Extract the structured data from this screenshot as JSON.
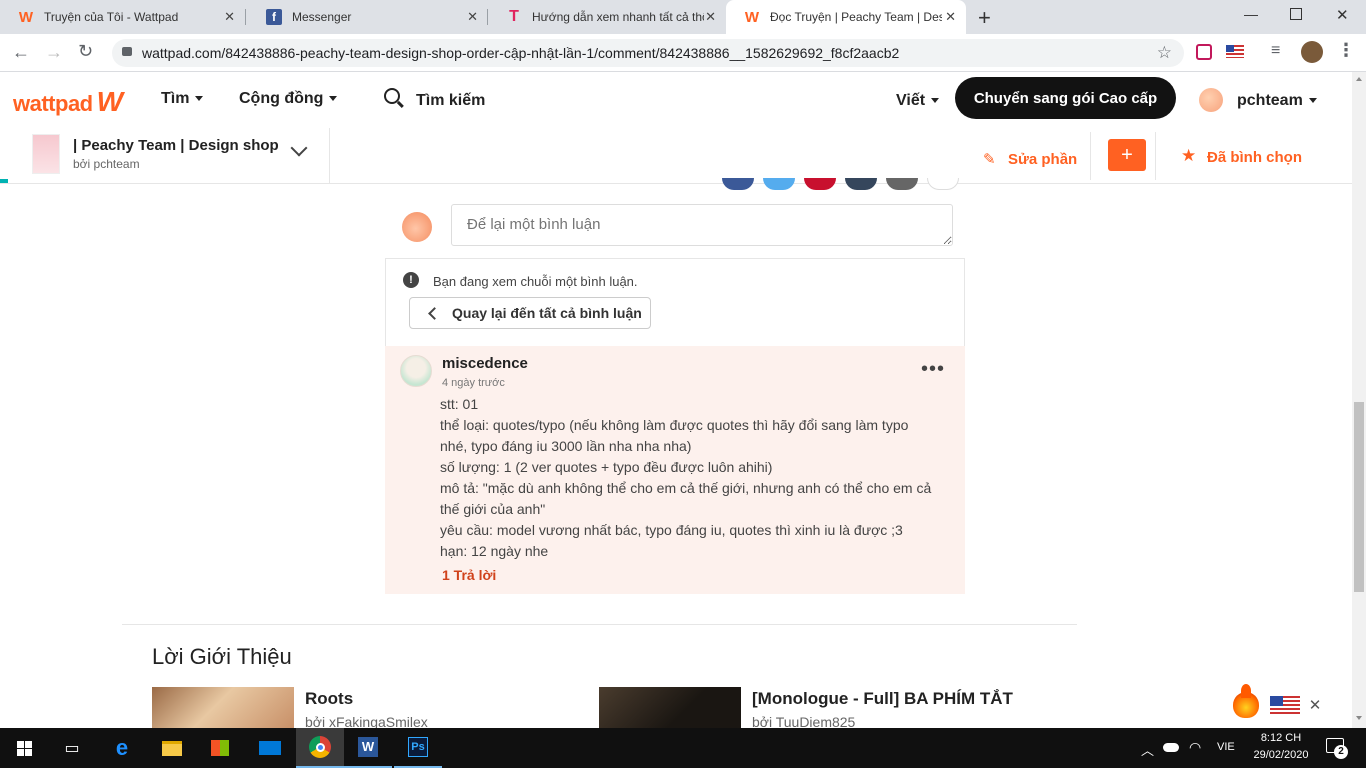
{
  "browser": {
    "tabs": [
      {
        "title": "Truyện của Tôi - Wattpad",
        "icon": "wattpad-logo"
      },
      {
        "title": "Messenger",
        "icon": "facebook-logo"
      },
      {
        "title": "Hướng dẫn xem nhanh tất cả thô",
        "icon": "t-logo"
      },
      {
        "title": "Đọc Truyện | Peachy Team | Desig",
        "icon": "wattpad-logo"
      }
    ],
    "url": "wattpad.com/842438886-peachy-team-design-shop-order-cập-nhật-lần-1/comment/842438886__1582629692_f8cf2aacb2"
  },
  "header": {
    "logo": "wattpad",
    "nav": {
      "browse": "Tìm",
      "community": "Cộng đồng",
      "search": "Tìm kiếm"
    },
    "write": "Viết",
    "premium_button": "Chuyển sang gói Cao cấp",
    "username": "pchteam"
  },
  "storybar": {
    "title": "| Peachy Team | Design shop",
    "author": "bởi pchteam",
    "edit_label": "Sửa phần",
    "add_label": "+",
    "voted_label": "Đã bình chọn"
  },
  "comment_box": {
    "placeholder": "Để lại một bình luận"
  },
  "thread_notice": {
    "text": "Bạn đang xem chuỗi một bình luận.",
    "back_label": "Quay lại đến tất cả bình luận"
  },
  "comment": {
    "author": "miscedence",
    "time": "4 ngày trước",
    "lines": [
      "stt: 01",
      "thể loại: quotes/typo (nếu không làm được quotes thì hãy đổi sang làm typo",
      "nhé, typo đáng iu 3000 lần nha nha nha)",
      "số lượng: 1 (2 ver quotes + typo đều được luôn ahihi)",
      "mô tả: \"mặc dù anh không thể cho em cả thế giới, nhưng anh có thể cho em cả",
      "thế giới của anh\"",
      "yêu cầu: model vương nhất bác, typo đáng iu, quotes thì xinh iu là được ;3",
      "hạn: 12 ngày nhe"
    ],
    "reply_label": "1 Trả lời",
    "menu_icon": "more-dots-icon"
  },
  "recommendations": {
    "heading": "Lời Giới Thiệu",
    "items": [
      {
        "title": "Roots",
        "author": "bởi xFakingaSmilex"
      },
      {
        "title": "[Monologue - Full] BA PHÍM TẮT",
        "author": "bởi TuuDiem825"
      }
    ]
  },
  "taskbar": {
    "language": "VIE",
    "time": "8:12 CH",
    "date": "29/02/2020",
    "notification_count": "2"
  },
  "colors": {
    "accent": "#ff6122",
    "dark_button": "#121212",
    "comment_bg": "#fdf1ed",
    "reply": "#d0421b"
  }
}
